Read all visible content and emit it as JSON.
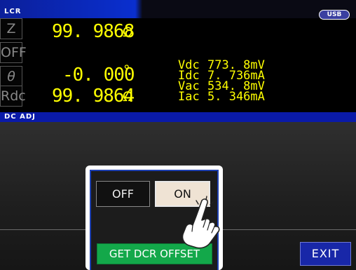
{
  "header": {
    "title": "LCR",
    "usb_label": "USB"
  },
  "params": [
    {
      "label": "Z",
      "value": "99. 9868",
      "unit": "Ω"
    },
    {
      "label": "OFF",
      "value": "",
      "unit": ""
    },
    {
      "label": "θ",
      "value": "-0. 000",
      "unit": "°"
    },
    {
      "label": "Rdc",
      "value": "99. 9864",
      "unit": "Ω"
    }
  ],
  "monitor": {
    "vdc": {
      "label": "Vdc",
      "value": "773. 8mV"
    },
    "idc": {
      "label": "Idc",
      "value": "7. 736mA"
    },
    "vac": {
      "label": "Vac",
      "value": "534. 8mV"
    },
    "iac": {
      "label": "Iac",
      "value": "5. 346mA"
    }
  },
  "section": {
    "title": "DC ADJ"
  },
  "buttons": {
    "off": "OFF",
    "on": "ON",
    "get_dcr_offset": "GET DCR OFFSET",
    "exit": "EXIT"
  },
  "colors": {
    "value_text": "#ffff00",
    "title_bar": "#0a2fcf",
    "on_button": "#efe3d4",
    "dcr_button": "#13a84a",
    "exit_button": "#1827a8"
  },
  "icons": {
    "pointer": "hand-pointer-icon"
  }
}
